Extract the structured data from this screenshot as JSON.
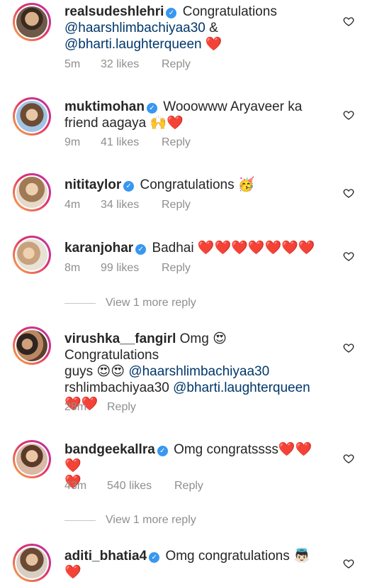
{
  "icons": {
    "like": "heart-outline-icon",
    "verified": "verified-badge-icon"
  },
  "colors": {
    "mention": "#00376b",
    "verified": "#3897f0",
    "meta": "#8e8e8e",
    "heart": "#ed4956"
  },
  "comments": [
    {
      "username": "realsudeshlehri",
      "line1": "Congratulations",
      "mention1": "@haarshlimbachiyaa30",
      "amp": "&",
      "mention2": "@bharti.laughterqueen",
      "emoji": "❤️",
      "time": "5m",
      "likes": "32 likes",
      "reply": "Reply"
    },
    {
      "username": "muktimohan",
      "text1": "Wooowww Aryaveer ka",
      "text2": "friend aagaya",
      "emoji": "🙌❤️",
      "time": "9m",
      "likes": "41 likes",
      "reply": "Reply"
    },
    {
      "username": "nititaylor",
      "text": "Congratulations",
      "emoji": "🥳",
      "time": "4m",
      "likes": "34 likes",
      "reply": "Reply"
    },
    {
      "username": "karanjohar",
      "text": "Badhai",
      "emoji": "❤️❤️❤️❤️❤️❤️❤️",
      "time": "8m",
      "likes": "99 likes",
      "reply": "Reply",
      "view_more": "View 1 more reply"
    },
    {
      "username": "virushka__fangirl",
      "text1": "Omg",
      "emoji1": "😍",
      "text2": "Congratulations",
      "text3": "guys",
      "emoji2": "😍😍",
      "mention1": "@haarshlimbachiyaa30",
      "text4": "rshlimbachiyaa30",
      "mention2": "@bharti.laughterqueen",
      "emoji3": "❤️❤️",
      "time": "28m",
      "reply": "Reply"
    },
    {
      "username": "bandgeekallra",
      "text": "Omg congratssss",
      "emoji1": "❤️❤️❤️",
      "emoji2": "❤️",
      "time": "43m",
      "likes": "540 likes",
      "reply": "Reply",
      "view_more": "View 1 more reply"
    },
    {
      "username": "aditi_bhatia4",
      "text": "Omg congratulations",
      "emoji": "👼🏻❤️"
    }
  ]
}
